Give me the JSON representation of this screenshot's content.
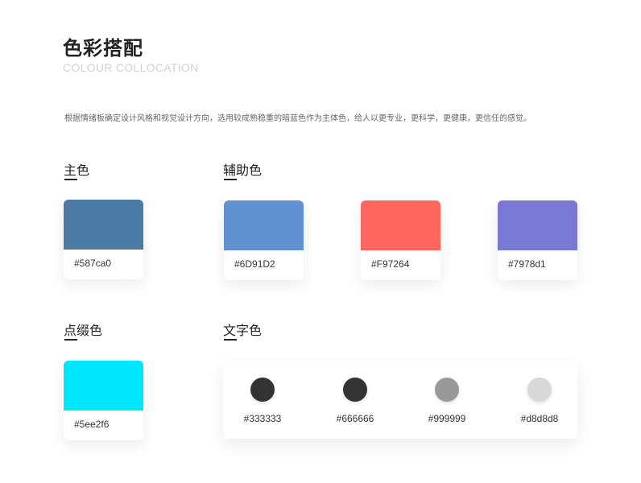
{
  "header": {
    "title": "色彩搭配",
    "subtitle": "COLOUR COLLOCATION",
    "description": "根据情绪板确定设计风格和视觉设计方向，选用较成熟稳重的暗蓝色作为主体色，给人以更专业，更科学，更健康，更信任的感觉。"
  },
  "primary": {
    "label": "主色",
    "swatches": [
      {
        "code": "#587ca0",
        "color": "#4b7ba4"
      }
    ]
  },
  "secondary": {
    "label": "辅助色",
    "swatches": [
      {
        "code": "#6D91D2",
        "color": "#6291d2"
      },
      {
        "code": "#F97264",
        "color": "#fe665f"
      },
      {
        "code": "#7978d1",
        "color": "#7979d4"
      }
    ]
  },
  "accent": {
    "label": "点缀色",
    "swatches": [
      {
        "code": "#5ee2f6",
        "color": "#00e7fd"
      }
    ]
  },
  "text_colors": {
    "label": "文字色",
    "swatches": [
      {
        "code": "#333333",
        "color": "#333333"
      },
      {
        "code": "#666666",
        "color": "#333333"
      },
      {
        "code": "#999999",
        "color": "#999999"
      },
      {
        "code": "#d8d8d8",
        "color": "#d8d8d8"
      }
    ]
  }
}
